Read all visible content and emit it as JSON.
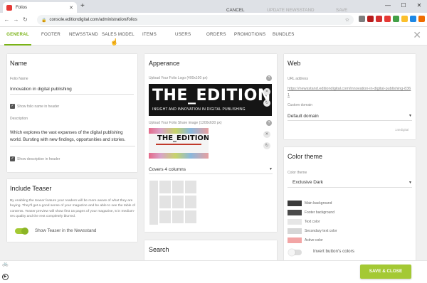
{
  "browser": {
    "tab_title": "Folios",
    "url": "console.editiondigital.com/administration/folios"
  },
  "nav": {
    "tabs": [
      "GENERAL",
      "FOOTER",
      "NEWSSTAND",
      "SALES MODEL",
      "ITEMS",
      "USERS",
      "ORDERS",
      "PROMOTIONS",
      "BUNDLES"
    ],
    "active": "GENERAL"
  },
  "name_card": {
    "title": "Name",
    "folio_name_label": "Folio Name",
    "folio_name_value": "Innovation in digital publishing",
    "show_name_label": "Show folio name in header",
    "description_label": "Description",
    "description_text": "Which explores the vast expanses of the digital publishing world. Bursting with new findings, opportunities and stories.",
    "show_desc_label": "Show description in header"
  },
  "teaser_card": {
    "title": "Include Teaser",
    "text": "By enabling the teaser feature your readers will be more aware of what they are buying. They'll get a good sense of your magazine and be able to see the table of contents. Teaser preview will show first 15 pages of your magazine, 5 in medium-res quality and the rest completely blurred.",
    "toggle_label": "Show Teaser in the Newsstand",
    "toggle_on": true
  },
  "appearance_card": {
    "title": "Apperance",
    "logo_label": "Upload Your Folio Logo (400x100 px)",
    "logo_big": "THE_EDITION",
    "logo_small": "INSIGHT AND INNOVATION IN DIGITAL PUBLISHING",
    "share_label": "Upload Your Folio Share image (1200x630 px)",
    "share_big": "THE_EDITION",
    "columns_value": "Covers 4 columns"
  },
  "search_card": {
    "title": "Search"
  },
  "web_card": {
    "title": "Web",
    "url_label": "URL address",
    "url_value": "https://newsstand.editiondigital.com/innovation-in-digital-publishing-8361",
    "domain_label": "Custom domain",
    "domain_value": "Default domain",
    "domain_hint": "14edigital"
  },
  "color_card": {
    "title": "Color theme",
    "theme_label": "Color theme",
    "theme_value": "Exclusive Dark",
    "swatches": [
      {
        "label": "Main background",
        "color": "#3a3a3a"
      },
      {
        "label": "Footer background",
        "color": "#4a4a4a"
      },
      {
        "label": "Text color",
        "color": "#e6e6e6"
      },
      {
        "label": "Secondary text color",
        "color": "#d6d6d6"
      },
      {
        "label": "Active color",
        "color": "#f2a5a5"
      }
    ],
    "invert_label": "Invert button's colors"
  },
  "footer": {
    "cancel": "CANCEL",
    "update": "UPDATE NEWSSTAND",
    "save": "SAVE",
    "save_close": "SAVE & CLOSE"
  },
  "colors": {
    "accent": "#7ab317",
    "save_button": "#a4c934",
    "toggle_on": "#a4c934"
  }
}
